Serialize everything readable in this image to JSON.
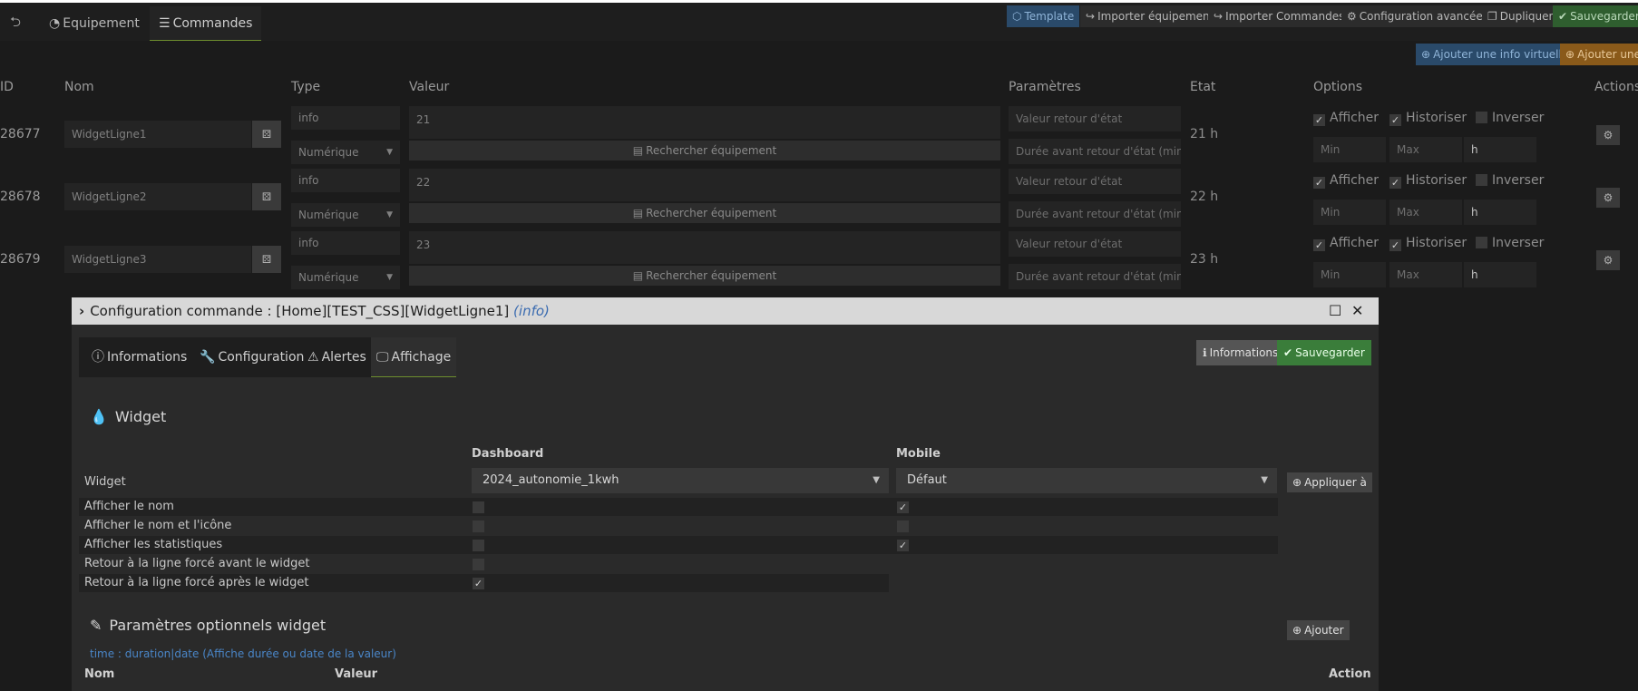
{
  "navbar": {
    "tabs": [
      {
        "label": "Equipement",
        "icon": "dashboard-icon"
      },
      {
        "label": "Commandes",
        "icon": "list-icon"
      }
    ],
    "buttons": [
      {
        "label": "Template",
        "icon": "cubes-icon"
      },
      {
        "label": "Importer équipement",
        "icon": "share-icon"
      },
      {
        "label": "Importer Commandes",
        "icon": "share-icon"
      },
      {
        "label": "Configuration avancée",
        "icon": "cogs-icon"
      },
      {
        "label": "Dupliquer",
        "icon": "copy-icon"
      },
      {
        "label": "Sauvegarder",
        "icon": "check-circle-icon"
      }
    ]
  },
  "actions_bar": {
    "add_virtual_info": "Ajouter une info virtuelle",
    "add_other": "Ajouter une a"
  },
  "table": {
    "headers": [
      "ID",
      "Nom",
      "Type",
      "Valeur",
      "Paramètres",
      "Etat",
      "Options",
      "Actions"
    ],
    "search_label": "Rechercher équipement",
    "param_placeholder_1": "Valeur retour d'état",
    "param_placeholder_2": "Durée avant retour d'état (min)",
    "min_placeholder": "Min",
    "max_placeholder": "Max",
    "option_labels": [
      "Afficher",
      "Historiser",
      "Inverser"
    ],
    "rows": [
      {
        "id": "28677",
        "name": "WidgetLigne1",
        "type": "info",
        "subtype": "Numérique",
        "value": "21",
        "unit": "h",
        "state": "21 h"
      },
      {
        "id": "28678",
        "name": "WidgetLigne2",
        "type": "info",
        "subtype": "Numérique",
        "value": "22",
        "unit": "h",
        "state": "22 h"
      },
      {
        "id": "28679",
        "name": "WidgetLigne3",
        "type": "info",
        "subtype": "Numérique",
        "value": "23",
        "unit": "h",
        "state": "23 h"
      }
    ]
  },
  "modal": {
    "title_prefix": "Configuration commande : [Home][TEST_CSS][WidgetLigne1]",
    "title_type": "(info)",
    "tabs": [
      {
        "label": "Informations",
        "icon": "info-circle-icon"
      },
      {
        "label": "Configuration",
        "icon": "wrench-icon"
      },
      {
        "label": "Alertes",
        "icon": "warning-icon"
      },
      {
        "label": "Affichage",
        "icon": "desktop-icon"
      }
    ],
    "btn_informations": "Informations",
    "btn_save": "Sauvegarder",
    "widget_section": "Widget",
    "col_dashboard": "Dashboard",
    "col_mobile": "Mobile",
    "widget_label": "Widget",
    "dashboard_widget": "2024_autonomie_1kwh",
    "mobile_widget": "Défaut",
    "apply_button": "Appliquer à",
    "options": [
      {
        "label": "Afficher le nom",
        "dashboard": false,
        "mobile": true
      },
      {
        "label": "Afficher le nom et l'icône",
        "dashboard": false,
        "mobile": false
      },
      {
        "label": "Afficher les statistiques",
        "dashboard": false,
        "mobile": true
      },
      {
        "label": "Retour à la ligne forcé avant le widget",
        "dashboard": false,
        "mobile": null
      },
      {
        "label": "Retour à la ligne forcé après le widget",
        "dashboard": true,
        "mobile": null
      }
    ],
    "params_section": "Paramètres optionnels widget",
    "add_button": "Ajouter",
    "hint": "time : duration|date (Affiche durée ou date de la valeur)",
    "col_nom": "Nom",
    "col_valeur": "Valeur",
    "col_action": "Action"
  }
}
